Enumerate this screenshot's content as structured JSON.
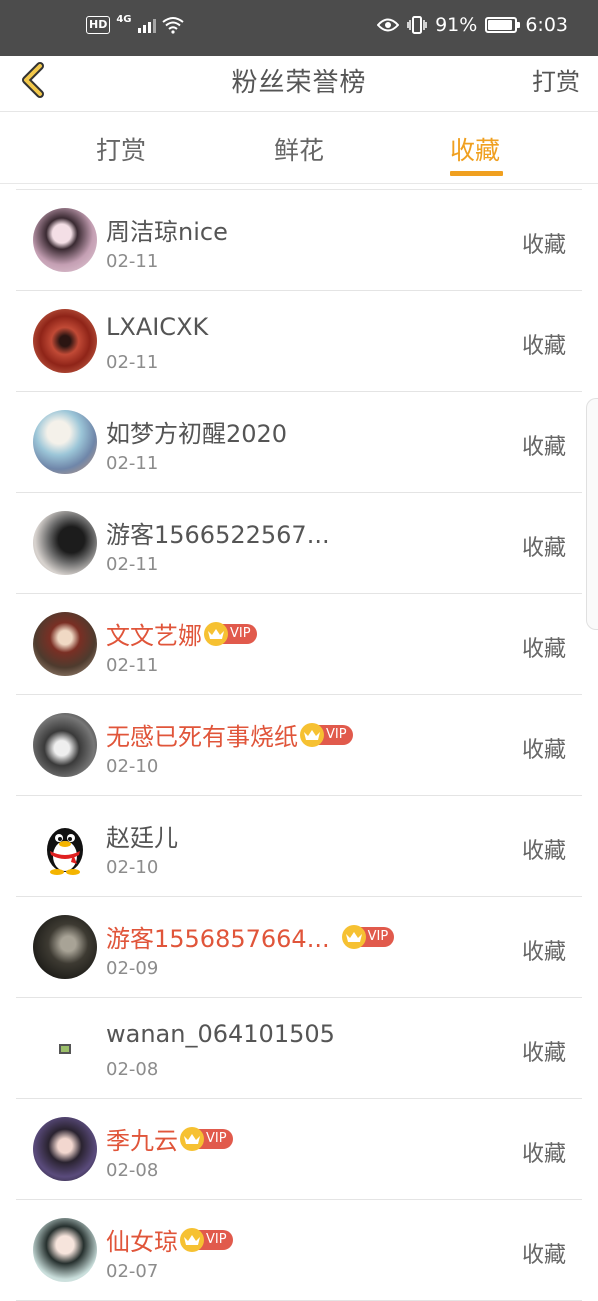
{
  "status_bar": {
    "hd": "HD",
    "network": "4G",
    "battery": "91%",
    "battery_level": 0.91,
    "time": "6:03"
  },
  "nav": {
    "title": "粉丝荣誉榜",
    "action": "打赏"
  },
  "tabs": [
    {
      "label": "打赏",
      "active": false
    },
    {
      "label": "鲜花",
      "active": false
    },
    {
      "label": "收藏",
      "active": true
    }
  ],
  "accent_color": "#f0a020",
  "vip_name_color": "#e0553a",
  "fans": [
    {
      "name": "周洁琼nice",
      "date": "02-11",
      "action": "收藏",
      "vip": false,
      "vip_label": ""
    },
    {
      "name": "LXAICXK",
      "date": "02-11",
      "action": "收藏",
      "vip": false,
      "vip_label": ""
    },
    {
      "name": "如梦方初醒2020",
      "date": "02-11",
      "action": "收藏",
      "vip": false,
      "vip_label": ""
    },
    {
      "name": "游客1566522567...",
      "date": "02-11",
      "action": "收藏",
      "vip": false,
      "vip_label": ""
    },
    {
      "name": "文文艺娜",
      "date": "02-11",
      "action": "收藏",
      "vip": true,
      "vip_label": "VIP"
    },
    {
      "name": "无感已死有事烧纸",
      "date": "02-10",
      "action": "收藏",
      "vip": true,
      "vip_label": "VIP"
    },
    {
      "name": "赵廷儿",
      "date": "02-10",
      "action": "收藏",
      "vip": false,
      "vip_label": ""
    },
    {
      "name": "游客1556857664...",
      "date": "02-09",
      "action": "收藏",
      "vip": true,
      "vip_label": "VIP"
    },
    {
      "name": "wanan_064101505",
      "date": "02-08",
      "action": "收藏",
      "vip": false,
      "vip_label": ""
    },
    {
      "name": "季九云",
      "date": "02-08",
      "action": "收藏",
      "vip": true,
      "vip_label": "VIP"
    },
    {
      "name": "仙女琼",
      "date": "02-07",
      "action": "收藏",
      "vip": true,
      "vip_label": "VIP"
    }
  ]
}
